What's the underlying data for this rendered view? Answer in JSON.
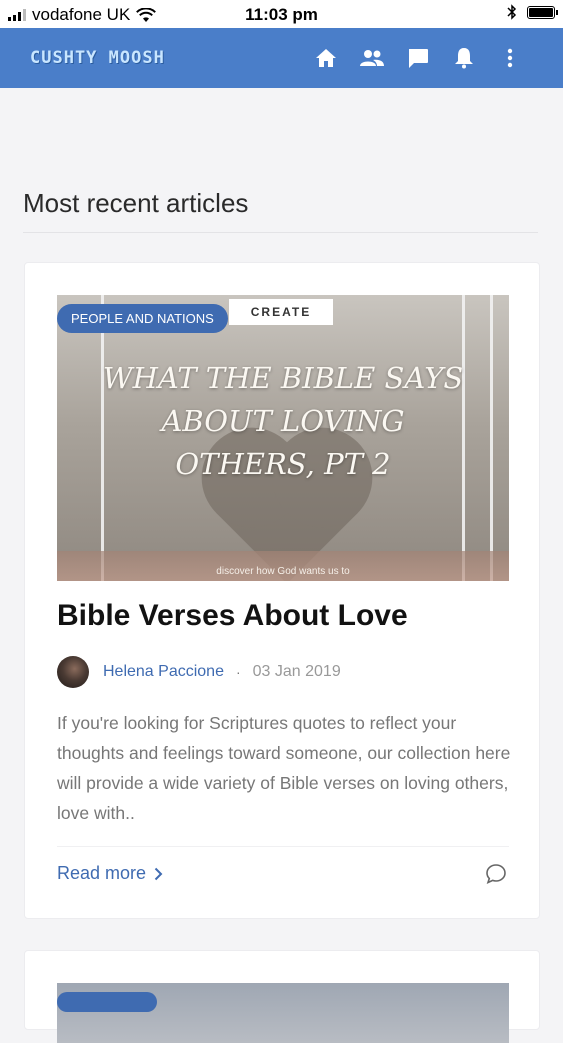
{
  "status_bar": {
    "carrier": "vodafone UK",
    "time": "11:03 pm"
  },
  "app_bar": {
    "logo": "CUSHTY MOOSH",
    "icons": [
      "home-icon",
      "people-icon",
      "chat-icon",
      "bell-icon",
      "more-vert-icon"
    ]
  },
  "section": {
    "title": "Most recent articles"
  },
  "article": {
    "category": "PEOPLE AND NATIONS",
    "image_tag": "CREATE",
    "image_title": "WHAT THE BIBLE SAYS ABOUT LOVING OTHERS, PT 2",
    "image_subtitle": "discover how God wants us to",
    "title": "Bible Verses About Love",
    "author": "Helena Paccione",
    "separator": "·",
    "date": "03 Jan 2019",
    "excerpt": "If you're looking for Scriptures quotes to reflect your thoughts and feelings toward someone, our collection here will provide a wide variety of Bible verses on loving others, love with..",
    "read_more": "Read more"
  },
  "colors": {
    "app_bar": "#4a7ec9",
    "accent": "#3f6bb1",
    "background": "#f4f4f6"
  }
}
